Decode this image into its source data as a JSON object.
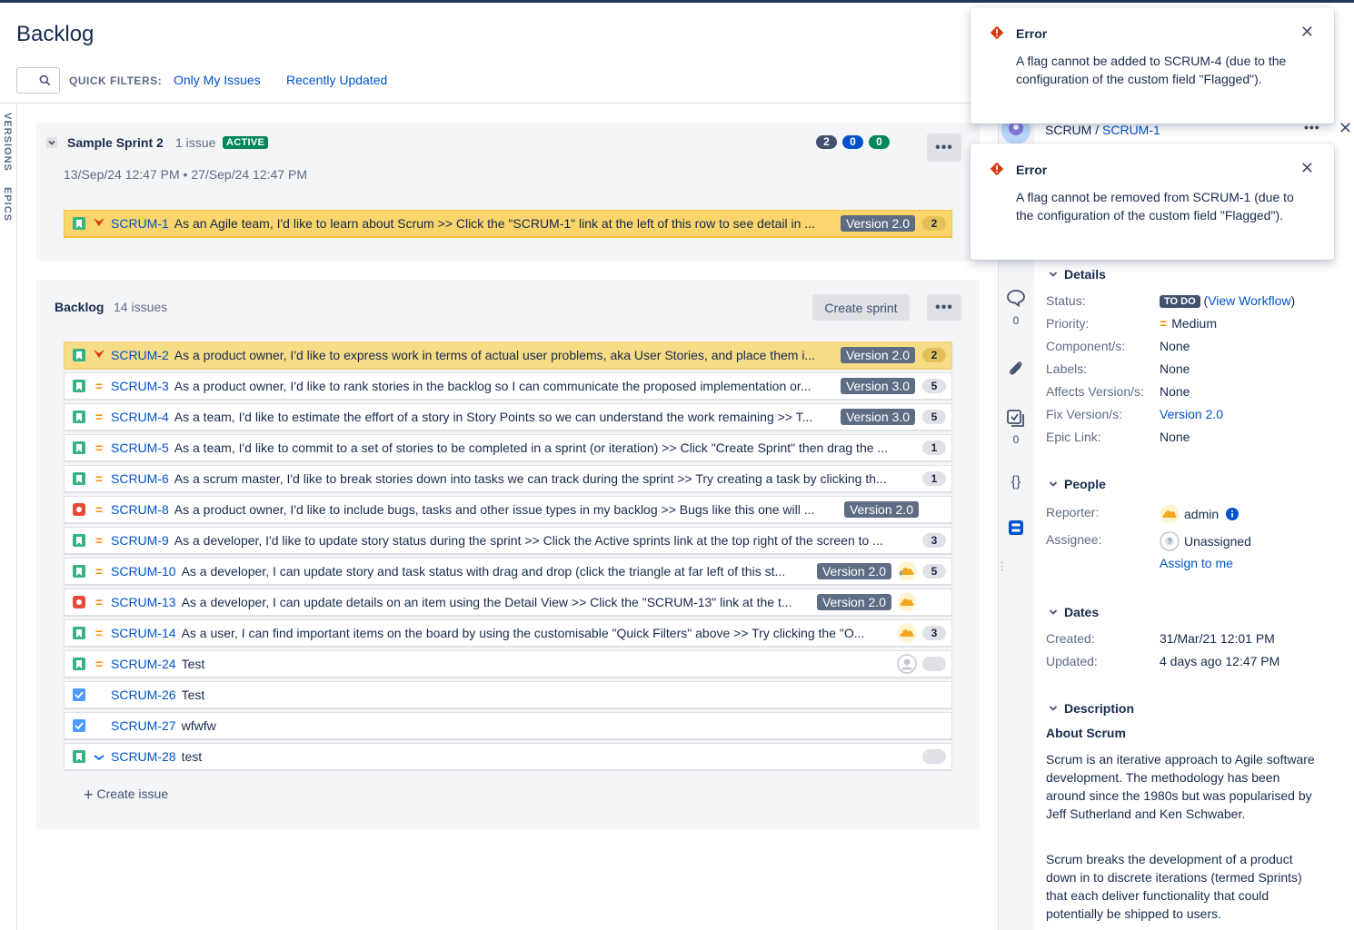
{
  "header": {
    "title": "Backlog",
    "quick_filters_label": "QUICK FILTERS:",
    "quick_filters": [
      "Only My Issues",
      "Recently Updated"
    ],
    "left_rail": [
      "VERSIONS",
      "EPICS"
    ]
  },
  "sprint": {
    "name": "Sample Sprint 2",
    "issue_count": "1 issue",
    "status": "ACTIVE",
    "dates": "13/Sep/24 12:47 PM  •  27/Sep/24 12:47 PM",
    "counts": [
      "2",
      "0",
      "0"
    ],
    "colors": {
      "todo": "#42526e",
      "inprogress": "#0052cc",
      "done": "#00875a"
    },
    "issues": [
      {
        "key": "SCRUM-1",
        "summary": "As an Agile team, I'd like to learn about Scrum >> Click the \"SCRUM-1\" link at the left of this row to see detail in ...",
        "version": "Version 2.0",
        "points": "2"
      }
    ]
  },
  "backlog": {
    "name": "Backlog",
    "issue_count": "14 issues",
    "create_sprint_label": "Create sprint",
    "create_issue_label": "Create issue",
    "issues": [
      {
        "key": "SCRUM-2",
        "summary": "As a product owner, I'd like to express work in terms of actual user problems, aka User Stories, and place them i...",
        "version": "Version 2.0",
        "points": "2"
      },
      {
        "key": "SCRUM-3",
        "summary": "As a product owner, I'd like to rank stories in the backlog so I can communicate the proposed implementation or...",
        "version": "Version 3.0",
        "points": "5"
      },
      {
        "key": "SCRUM-4",
        "summary": "As a team, I'd like to estimate the effort of a story in Story Points so we can understand the work remaining >> T...",
        "version": "Version 3.0",
        "points": "5"
      },
      {
        "key": "SCRUM-5",
        "summary": "As a team, I'd like to commit to a set of stories to be completed in a sprint (or iteration) >> Click \"Create Sprint\" then drag the ...",
        "version": "",
        "points": "1"
      },
      {
        "key": "SCRUM-6",
        "summary": "As a scrum master, I'd like to break stories down into tasks we can track during the sprint >> Try creating a task by clicking th...",
        "version": "",
        "points": "1"
      },
      {
        "key": "SCRUM-8",
        "summary": "As a product owner, I'd like to include bugs, tasks and other issue types in my backlog >> Bugs like this one will ...",
        "version": "Version 2.0",
        "points": ""
      },
      {
        "key": "SCRUM-9",
        "summary": "As a developer, I'd like to update story status during the sprint >> Click the Active sprints link at the top right of the screen to ...",
        "version": "",
        "points": "3"
      },
      {
        "key": "SCRUM-10",
        "summary": "As a developer, I can update story and task status with drag and drop (click the triangle at far left of this st...",
        "version": "Version 2.0",
        "points": "5"
      },
      {
        "key": "SCRUM-13",
        "summary": "As a developer, I can update details on an item using the Detail View >> Click the \"SCRUM-13\" link at the t...",
        "version": "Version 2.0",
        "points": ""
      },
      {
        "key": "SCRUM-14",
        "summary": "As a user, I can find important items on the board by using the customisable \"Quick Filters\" above >> Try clicking the \"O...",
        "version": "",
        "points": "3"
      },
      {
        "key": "SCRUM-24",
        "summary": "Test",
        "version": "",
        "points": ""
      },
      {
        "key": "SCRUM-26",
        "summary": "Test",
        "version": "",
        "points": ""
      },
      {
        "key": "SCRUM-27",
        "summary": "wfwfw",
        "version": "",
        "points": ""
      },
      {
        "key": "SCRUM-28",
        "summary": "test",
        "version": "",
        "points": ""
      }
    ]
  },
  "detail": {
    "project": "SCRUM",
    "issue_key": "SCRUM-1",
    "rail_counts": [
      "0",
      "0"
    ],
    "details_heading": "Details",
    "fields": [
      {
        "label": "Status:",
        "value": "TO DO",
        "extra": "View Workflow"
      },
      {
        "label": "Priority:",
        "value": "Medium"
      },
      {
        "label": "Component/s:",
        "value": "None"
      },
      {
        "label": "Labels:",
        "value": "None"
      },
      {
        "label": "Affects Version/s:",
        "value": "None"
      },
      {
        "label": "Fix Version/s:",
        "value": "Version 2.0"
      },
      {
        "label": "Epic Link:",
        "value": "None"
      }
    ],
    "people_heading": "People",
    "reporter_label": "Reporter:",
    "reporter": "admin",
    "assignee_label": "Assignee:",
    "assignee": "Unassigned",
    "assign_to_me": "Assign to me",
    "dates_heading": "Dates",
    "created_label": "Created:",
    "created": "31/Mar/21 12:01 PM",
    "updated_label": "Updated:",
    "updated": "4 days ago 12:47 PM",
    "description_heading": "Description",
    "description_title": "About Scrum",
    "description_p1": "Scrum is an iterative approach to Agile software development. The methodology has been around since the 1980s but was popularised by Jeff Sutherland and Ken Schwaber.",
    "description_p2": "Scrum breaks the development of a product down in to discrete iterations (termed Sprints) that each deliver functionality that could potentially be shipped to users."
  },
  "flags": [
    {
      "title": "Error",
      "message": "A flag cannot be added to SCRUM-4 (due to the configuration of the custom field \"Flagged\")."
    },
    {
      "title": "Error",
      "message": "A flag cannot be removed from SCRUM-1 (due to the configuration of the custom field \"Flagged\")."
    }
  ]
}
